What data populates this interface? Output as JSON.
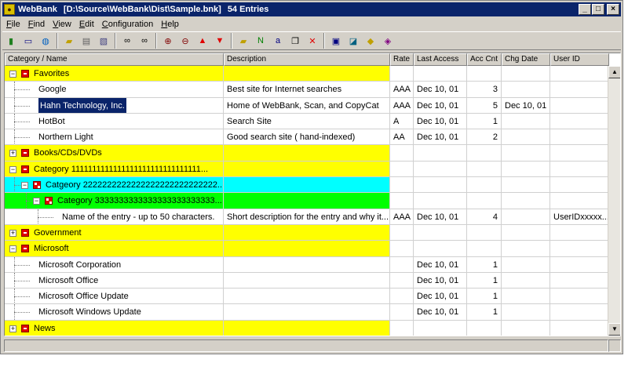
{
  "window": {
    "app_name": "WebBank",
    "file_path": "[D:\\Source\\WebBank\\Dist\\Sample.bnk]",
    "entry_count": "54 Entries"
  },
  "menu": [
    "File",
    "Find",
    "View",
    "Edit",
    "Configuration",
    "Help"
  ],
  "toolbar": [
    {
      "icon": "traffic-light-icon",
      "glyph": "▮",
      "color": "#208020"
    },
    {
      "icon": "window-icon",
      "glyph": "▭",
      "color": "#000080"
    },
    {
      "icon": "globe-icon",
      "glyph": "◍",
      "color": "#0060c0"
    },
    {
      "icon": "open-folder-icon",
      "glyph": "▰",
      "color": "#c0a000"
    },
    {
      "icon": "save-icon",
      "glyph": "▤",
      "color": "#606060"
    },
    {
      "icon": "print-preview-icon",
      "glyph": "▧",
      "color": "#404080"
    },
    {
      "icon": "binoculars-icon",
      "glyph": "∞",
      "color": "#000000"
    },
    {
      "icon": "find-next-icon",
      "glyph": "∞",
      "color": "#000000"
    },
    {
      "icon": "zoom-in-icon",
      "glyph": "⊕",
      "color": "#800000"
    },
    {
      "icon": "zoom-out-icon",
      "glyph": "⊖",
      "color": "#800000"
    },
    {
      "icon": "move-up-icon",
      "glyph": "▲",
      "color": "#e00000"
    },
    {
      "icon": "move-down-icon",
      "glyph": "▼",
      "color": "#e00000"
    },
    {
      "icon": "new-folder-icon",
      "glyph": "▰",
      "color": "#c0a000"
    },
    {
      "icon": "new-entry-icon",
      "glyph": "N",
      "color": "#008000"
    },
    {
      "icon": "rename-icon",
      "glyph": "a",
      "color": "#000080"
    },
    {
      "icon": "copy-icon",
      "glyph": "❐",
      "color": "#000000"
    },
    {
      "icon": "delete-icon",
      "glyph": "✕",
      "color": "#e00000"
    },
    {
      "icon": "properties-icon",
      "glyph": "▣",
      "color": "#000080"
    },
    {
      "icon": "export-icon",
      "glyph": "◪",
      "color": "#006080"
    },
    {
      "icon": "import-icon",
      "glyph": "◆",
      "color": "#c0a000"
    },
    {
      "icon": "help-book-icon",
      "glyph": "◈",
      "color": "#800080"
    }
  ],
  "columns": [
    "Category / Name",
    "Description",
    "Rate",
    "Last Access",
    "Acc Cnt",
    "Chg Date",
    "User ID"
  ],
  "rows": [
    {
      "level": 0,
      "type": "category",
      "expanded": true,
      "color": "yellow",
      "name": "Favorites",
      "desc": "",
      "rate": "",
      "last": "",
      "cnt": "",
      "chg": "",
      "uid": ""
    },
    {
      "level": 1,
      "type": "entry",
      "name": "Google",
      "desc": "Best site for Internet searches",
      "rate": "AAA",
      "last": "Dec 10, 01",
      "cnt": "3",
      "chg": "",
      "uid": ""
    },
    {
      "level": 1,
      "type": "entry",
      "selected": true,
      "name": "Hahn Technology, Inc.",
      "desc": "Home of WebBank, Scan, and CopyCat",
      "rate": "AAA",
      "last": "Dec 10, 01",
      "cnt": "5",
      "chg": "Dec 10, 01",
      "uid": ""
    },
    {
      "level": 1,
      "type": "entry",
      "name": "HotBot",
      "desc": "Search Site",
      "rate": "A",
      "last": "Dec 10, 01",
      "cnt": "1",
      "chg": "",
      "uid": ""
    },
    {
      "level": 1,
      "type": "entry",
      "name": "Northern Light",
      "desc": "Good search site ( hand-indexed)",
      "rate": "AA",
      "last": "Dec 10, 01",
      "cnt": "2",
      "chg": "",
      "uid": ""
    },
    {
      "level": 0,
      "type": "category",
      "expanded": false,
      "color": "yellow",
      "name": "Books/CDs/DVDs",
      "desc": "",
      "rate": "",
      "last": "",
      "cnt": "",
      "chg": "",
      "uid": ""
    },
    {
      "level": 0,
      "type": "category",
      "expanded": true,
      "color": "yellow",
      "name": "Category 1111111111111111111111111111111...",
      "desc": "",
      "rate": "",
      "last": "",
      "cnt": "",
      "chg": "",
      "uid": ""
    },
    {
      "level": 1,
      "type": "category",
      "expanded": true,
      "color": "cyan",
      "name": "Catgeory 2222222222222222222222222222...",
      "desc": "",
      "rate": "",
      "last": "",
      "cnt": "",
      "chg": "",
      "uid": ""
    },
    {
      "level": 2,
      "type": "category",
      "expanded": true,
      "color": "green",
      "name": "Category 3333333333333333333333333...",
      "desc": "",
      "rate": "",
      "last": "",
      "cnt": "",
      "chg": "",
      "uid": ""
    },
    {
      "level": 3,
      "type": "entry",
      "name": "Name of the entry - up to 50 characters.",
      "desc": "Short description for the entry and why it...",
      "rate": "AAA",
      "last": "Dec 10, 01",
      "cnt": "4",
      "chg": "",
      "uid": "UserIDxxxxx..."
    },
    {
      "level": 0,
      "type": "category",
      "expanded": false,
      "color": "yellow",
      "name": "Government",
      "desc": "",
      "rate": "",
      "last": "",
      "cnt": "",
      "chg": "",
      "uid": ""
    },
    {
      "level": 0,
      "type": "category",
      "expanded": true,
      "color": "yellow",
      "name": "Microsoft",
      "desc": "",
      "rate": "",
      "last": "",
      "cnt": "",
      "chg": "",
      "uid": ""
    },
    {
      "level": 1,
      "type": "entry",
      "name": "Microsoft Corporation",
      "desc": "",
      "rate": "",
      "last": "Dec 10, 01",
      "cnt": "1",
      "chg": "",
      "uid": ""
    },
    {
      "level": 1,
      "type": "entry",
      "name": "Microsoft Office",
      "desc": "",
      "rate": "",
      "last": "Dec 10, 01",
      "cnt": "1",
      "chg": "",
      "uid": ""
    },
    {
      "level": 1,
      "type": "entry",
      "name": "Microsoft Office Update",
      "desc": "",
      "rate": "",
      "last": "Dec 10, 01",
      "cnt": "1",
      "chg": "",
      "uid": ""
    },
    {
      "level": 1,
      "type": "entry",
      "name": "Microsoft Windows Update",
      "desc": "",
      "rate": "",
      "last": "Dec 10, 01",
      "cnt": "1",
      "chg": "",
      "uid": ""
    },
    {
      "level": 0,
      "type": "category",
      "expanded": false,
      "color": "yellow",
      "name": "News",
      "desc": "",
      "rate": "",
      "last": "",
      "cnt": "",
      "chg": "",
      "uid": ""
    }
  ]
}
